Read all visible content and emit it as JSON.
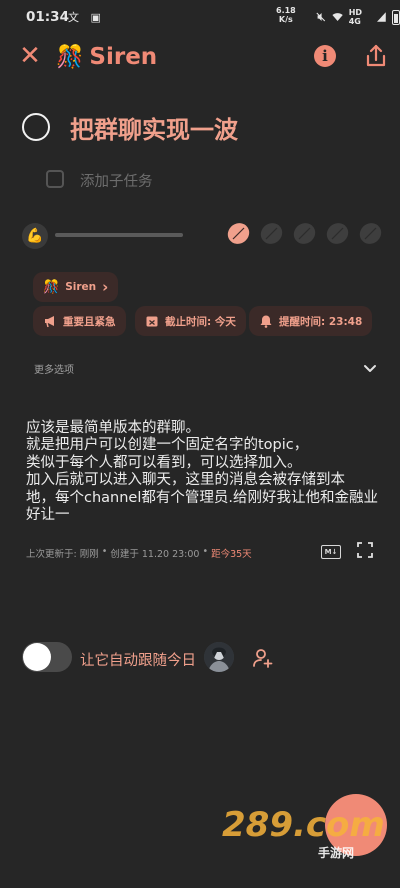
{
  "status_bar": {
    "time": "01:34",
    "left_icons": "文 ▣",
    "net_speed_value": "6.18",
    "net_speed_unit": "K/s",
    "network": "HD 4G"
  },
  "app_bar": {
    "title_emoji": "🎊",
    "title": "Siren",
    "info_glyph": "i"
  },
  "task": {
    "title": "把群聊实现一波",
    "subtask_placeholder": "添加子任务"
  },
  "progress": {
    "icon": "💪",
    "value": 0,
    "pomodoros_total": 5,
    "pomodoros_done": 1,
    "colors": {
      "active": "#f0a08c",
      "inactive": "#3e3e3e"
    }
  },
  "chips": {
    "project_emoji": "🎊",
    "project_label": "Siren",
    "project_chevron": "›",
    "priority_label": "重要且紧急",
    "due_label": "截止时间: 今天",
    "remind_label": "提醒时间: 23:48"
  },
  "more_options": "更多选项",
  "note_lines": [
    "应该是最简单版本的群聊。",
    "就是把用户可以创建一个固定名字的topic，",
    "类似于每个人都可以看到，可以选择加入。",
    "加入后就可以进入聊天，这里的消息会被存储到本",
    "地，每个channel都有个管理员.给刚好我让他和金融业",
    "好让一"
  ],
  "meta": {
    "updated": "上次更新于: 刚刚",
    "sep1": "•",
    "created": "创建于 11.20 23:00",
    "sep2": "•",
    "due_in": "距今35天",
    "md_label": "M↓"
  },
  "bottom": {
    "toggle_label": "让它自动跟随今日"
  },
  "watermark": {
    "text": "289.com",
    "sub": "手游网"
  },
  "colors": {
    "accent": "#f08a76",
    "background": "#262626",
    "chip_bg": "#3b2a28"
  }
}
